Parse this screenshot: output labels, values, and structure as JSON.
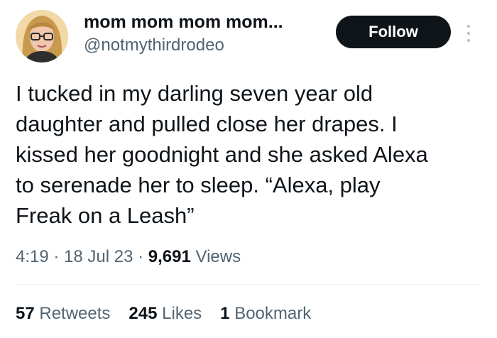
{
  "author": {
    "display_name": "mom mom mom mom...",
    "handle": "@notmythirdrodeo",
    "avatar_icon": "profile-photo"
  },
  "actions": {
    "follow_label": "Follow",
    "more_icon": "more-options-icon"
  },
  "tweet": {
    "lines": [
      "I tucked in my darling seven year old",
      "daughter and pulled close her drapes.  I",
      "kissed her goodnight and she asked Alexa",
      "to serenade her to sleep.  “Alexa, play",
      "Freak on a Leash”"
    ]
  },
  "meta": {
    "time": "4:19",
    "separator": " · ",
    "date": "18 Jul 23",
    "views_count": "9,691",
    "views_label": " Views"
  },
  "stats": {
    "retweets_count": "57",
    "retweets_label": " Retweets",
    "likes_count": "245",
    "likes_label": " Likes",
    "bookmarks_count": "1",
    "bookmarks_label": " Bookmark"
  },
  "colors": {
    "text_primary": "#0f1419",
    "text_secondary": "#536471",
    "follow_button_bg": "#0f1419",
    "follow_button_text": "#ffffff",
    "divider": "#eff3f4"
  }
}
